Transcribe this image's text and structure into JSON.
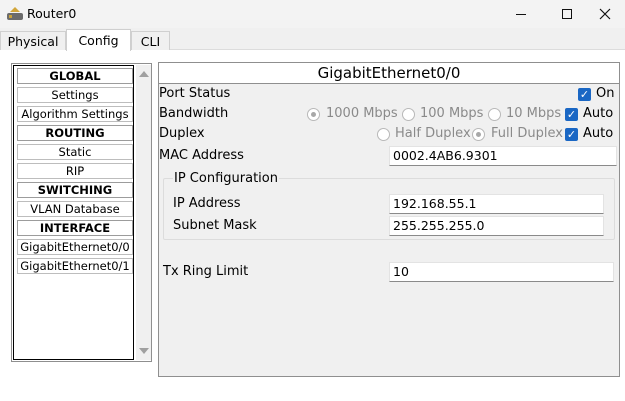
{
  "window": {
    "title": "Router0"
  },
  "tabs": [
    {
      "label": "Physical"
    },
    {
      "label": "Config"
    },
    {
      "label": "CLI"
    }
  ],
  "nav": {
    "items": [
      {
        "label": "GLOBAL",
        "header": true
      },
      {
        "label": "Settings"
      },
      {
        "label": "Algorithm Settings"
      },
      {
        "label": "ROUTING",
        "header": true
      },
      {
        "label": "Static"
      },
      {
        "label": "RIP"
      },
      {
        "label": "SWITCHING",
        "header": true
      },
      {
        "label": "VLAN Database"
      },
      {
        "label": "INTERFACE",
        "header": true
      },
      {
        "label": "GigabitEthernet0/0"
      },
      {
        "label": "GigabitEthernet0/1"
      }
    ]
  },
  "interface": {
    "title": "GigabitEthernet0/0",
    "port_status": {
      "label": "Port Status",
      "on_label": "On",
      "on_checked": true
    },
    "bandwidth": {
      "label": "Bandwidth",
      "options": [
        "1000 Mbps",
        "100 Mbps",
        "10 Mbps"
      ],
      "selected": "1000 Mbps",
      "auto_label": "Auto",
      "auto_checked": true
    },
    "duplex": {
      "label": "Duplex",
      "options": [
        "Half Duplex",
        "Full Duplex"
      ],
      "selected": "Full Duplex",
      "auto_label": "Auto",
      "auto_checked": true
    },
    "mac": {
      "label": "MAC Address",
      "value": "0002.4AB6.9301"
    },
    "ip_config": {
      "label": "IP Configuration",
      "ip_label": "IP Address",
      "ip_value": "192.168.55.1",
      "mask_label": "Subnet Mask",
      "mask_value": "255.255.255.0"
    },
    "tx_ring": {
      "label": "Tx Ring Limit",
      "value": "10"
    }
  },
  "colors": {
    "accent": "#1a67c4",
    "disabled_text": "#8a8a8a"
  }
}
